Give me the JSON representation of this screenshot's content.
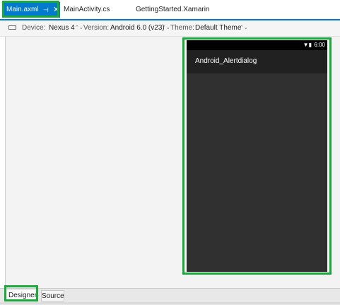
{
  "tabs": [
    {
      "label": "Main.axml",
      "pin": "⊣",
      "close": "✕"
    },
    {
      "label": "MainActivity.cs"
    },
    {
      "label": "GettingStarted.Xamarin"
    }
  ],
  "toolbar": {
    "device_label": "Device:",
    "device_value": "Nexus 4",
    "version_label": "Version:",
    "version_value": "Android 6.0 (v23)",
    "theme_label": "Theme:",
    "theme_value": "Default Theme",
    "caret": "⌃⌄"
  },
  "device": {
    "status_icons": "▼▮",
    "time": "6:00",
    "app_title": "Android_Alertdialog"
  },
  "bottom_tabs": {
    "designer": "Designer",
    "source": "Source"
  },
  "colors": {
    "accent": "#007acc",
    "highlight": "#1aaa3b",
    "device_bg": "#303030",
    "appbar_bg": "#212121"
  }
}
